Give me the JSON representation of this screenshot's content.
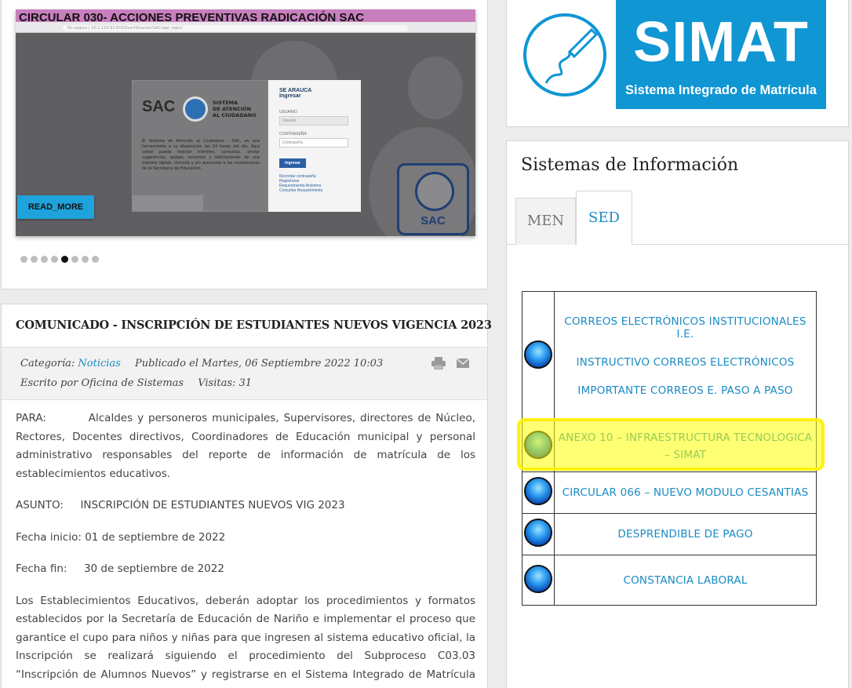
{
  "slider": {
    "caption": "CIRCULAR 030- ACCIONES PREVENTIVAS RADICACIÓN SAC",
    "read_more": "READ_MORE",
    "dots_count": 8,
    "active_dot": 5,
    "screenshot": {
      "address": "No seguro | 10.1.110.82:8193/certificacion/SAC/app_login/",
      "sac_logo": "SAC",
      "sac_sub_line1": "SISTEMA",
      "sac_sub_line2": "DE ATENCIÓN",
      "sac_sub_line3": "AL CIUDADANO",
      "sac_text": "El Sistema de Atención al Ciudadano - SAC, es una herramienta a su disposición las 24 horas del día. Aquí usted puede realizar trámites, consultas, enviar sugerencias, quejas, reclamos y felicitaciones de una manera rápida, cómoda y sin acercarse a las instalaciones de la Secretaría de Educación.",
      "login_title1": "SE ARAUCA",
      "login_title2": "Ingresar",
      "user_label": "USUARIO",
      "user_placeholder": "Usuario",
      "pass_label": "CONTRASEÑA",
      "pass_placeholder": "Contraseña",
      "login_button": "Ingresar",
      "links": [
        "Recordar contraseña",
        "Registrarse",
        "Requerimiento Anónimo",
        "Consultar Requerimiento"
      ],
      "badge": "SAC"
    }
  },
  "article": {
    "title": "COMUNICADO - INSCRIPCIÓN DE ESTUDIANTES NUEVOS VIGENCIA 2023",
    "category_label": "Categoría:",
    "category_value": "Noticias",
    "published": "Publicado el Martes, 06 Septiembre 2022 10:03",
    "author": "Escrito por Oficina de Sistemas",
    "visits": "Visitas: 31",
    "para_label": "PARA:",
    "para_text": "Alcaldes y personeros municipales, Supervisores, directores de Núcleo, Rectores, Docentes directivos, Coordinadores de Educación municipal y personal administrativo responsables del reporte de información de matrícula de los establecimientos educativos.",
    "asunto_label": "ASUNTO:",
    "asunto_text": "INSCRIPCIÓN DE ESTUDIANTES NUEVOS VIG 2023",
    "fecha_inicio_label": "Fecha inicio:",
    "fecha_inicio": "01 de septiembre de 2022",
    "fecha_fin_label": "Fecha fin:",
    "fecha_fin": "30 de septiembre de 2022",
    "body_para": "Los Establecimientos Educativos, deberán adoptar los procedimientos y formatos establecidos por la Secretaría de Educación de Nariño e implementar el proceso que garantice el cupo para niños y niñas para que ingresen al sistema educativo oficial, la Inscripción se realizará siguiendo el procedimiento del Subproceso C03.03 “Inscripción de Alumnos Nuevos” y registrarse en el Sistema Integrado de Matrícula SIMAT."
  },
  "simat": {
    "word": "SIMAT",
    "subtitle": "Sistema Integrado de Matrícula"
  },
  "info": {
    "title": "Sistemas de Información",
    "tabs": [
      {
        "label": "MEN"
      },
      {
        "label": "SED"
      }
    ],
    "active_tab": "SED",
    "links": {
      "correos": "CORREOS ELECTRÓNICOS INSTITUCIONALES I.E.",
      "instructivo": "INSTRUCTIVO CORREOS ELECTRÓNICOS",
      "importante": "IMPORTANTE CORREOS E. PASO A PASO",
      "anexo": "ANEXO 10 – INFRAESTRUCTURA TECNOLOGICA – SIMAT",
      "circular": "CIRCULAR 066 – NUEVO MODULO CESANTIAS",
      "desprendible": "DESPRENDIBLE DE PAGO",
      "constancia": "CONSTANCIA LABORAL"
    },
    "highlight_color": "#ffff00",
    "link_color": "#1a8bc4"
  }
}
